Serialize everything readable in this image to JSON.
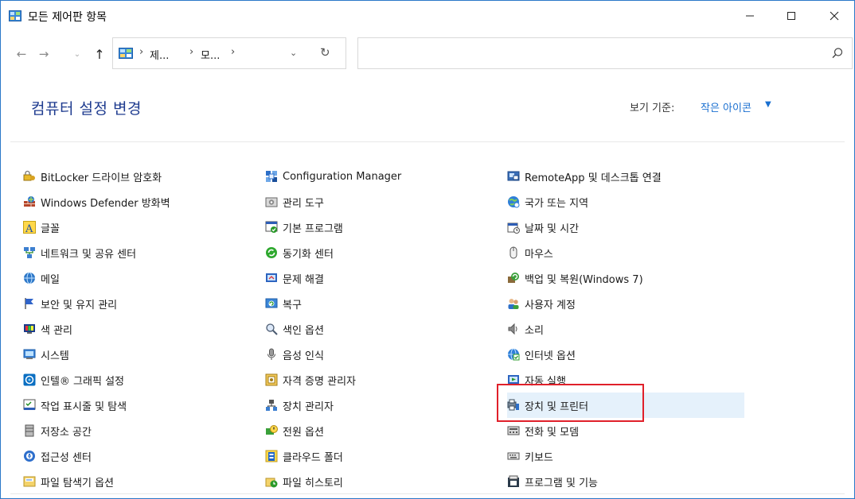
{
  "window": {
    "title": "모든 제어판 항목",
    "minimize_glyph": "—",
    "maximize_glyph": "☐",
    "close_glyph": "✕"
  },
  "navigation": {
    "back_glyph": "←",
    "forward_glyph": "→",
    "recent_glyph": "⌄",
    "up_glyph": "↑",
    "breadcrumb": [
      "제...",
      "모..."
    ],
    "breadcrumb_sep": "›",
    "dropdown_glyph": "⌄",
    "refresh_glyph": "↻",
    "search_placeholder": ""
  },
  "header": {
    "title": "컴퓨터 설정 변경",
    "view_by_label": "보기 기준:",
    "view_by_value": "작은 아이콘",
    "view_by_caret": "▼"
  },
  "columns": [
    [
      {
        "label": "BitLocker 드라이브 암호화",
        "icon": "bitlocker-icon"
      },
      {
        "label": "Windows Defender 방화벽",
        "icon": "firewall-icon"
      },
      {
        "label": "글꼴",
        "icon": "fonts-icon"
      },
      {
        "label": "네트워크 및 공유 센터",
        "icon": "network-icon"
      },
      {
        "label": "메일",
        "icon": "mail-icon"
      },
      {
        "label": "보안 및 유지 관리",
        "icon": "flag-icon"
      },
      {
        "label": "색 관리",
        "icon": "color-management-icon"
      },
      {
        "label": "시스템",
        "icon": "system-icon"
      },
      {
        "label": "인텔® 그래픽 설정",
        "icon": "intel-graphics-icon"
      },
      {
        "label": "작업 표시줄 및 탐색",
        "icon": "taskbar-icon"
      },
      {
        "label": "저장소 공간",
        "icon": "storage-icon"
      },
      {
        "label": "접근성 센터",
        "icon": "accessibility-icon"
      },
      {
        "label": "파일 탐색기 옵션",
        "icon": "folder-options-icon"
      }
    ],
    [
      {
        "label": "Configuration Manager",
        "icon": "configuration-manager-icon"
      },
      {
        "label": "관리 도구",
        "icon": "admin-tools-icon"
      },
      {
        "label": "기본 프로그램",
        "icon": "default-programs-icon"
      },
      {
        "label": "동기화 센터",
        "icon": "sync-center-icon"
      },
      {
        "label": "문제 해결",
        "icon": "troubleshoot-icon"
      },
      {
        "label": "복구",
        "icon": "recovery-icon"
      },
      {
        "label": "색인 옵션",
        "icon": "indexing-icon"
      },
      {
        "label": "음성 인식",
        "icon": "microphone-icon"
      },
      {
        "label": "자격 증명 관리자",
        "icon": "credential-icon"
      },
      {
        "label": "장치 관리자",
        "icon": "device-manager-icon"
      },
      {
        "label": "전원 옵션",
        "icon": "power-icon"
      },
      {
        "label": "클라우드 폴더",
        "icon": "cloud-folder-icon"
      },
      {
        "label": "파일 히스토리",
        "icon": "file-history-icon"
      }
    ],
    [
      {
        "label": "RemoteApp 및 데스크톱 연결",
        "icon": "remoteapp-icon"
      },
      {
        "label": "국가 또는 지역",
        "icon": "region-icon"
      },
      {
        "label": "날짜 및 시간",
        "icon": "date-time-icon"
      },
      {
        "label": "마우스",
        "icon": "mouse-icon"
      },
      {
        "label": "백업 및 복원(Windows 7)",
        "icon": "backup-icon"
      },
      {
        "label": "사용자 계정",
        "icon": "user-accounts-icon"
      },
      {
        "label": "소리",
        "icon": "speaker-icon"
      },
      {
        "label": "인터넷 옵션",
        "icon": "internet-options-icon"
      },
      {
        "label": "자동 실행",
        "icon": "autoplay-icon"
      },
      {
        "label": "장치 및 프린터",
        "icon": "devices-printers-icon",
        "hovered": true
      },
      {
        "label": "전화 및 모뎀",
        "icon": "phone-modem-icon"
      },
      {
        "label": "키보드",
        "icon": "keyboard-icon"
      },
      {
        "label": "프로그램 및 기능",
        "icon": "programs-features-icon"
      }
    ]
  ],
  "colors": {
    "title_blue": "#1e3b8f",
    "link_blue": "#1a6fd0",
    "hover_bg": "#e5f1fb",
    "highlight_red": "#e0202a",
    "window_border": "#2b78c8"
  }
}
